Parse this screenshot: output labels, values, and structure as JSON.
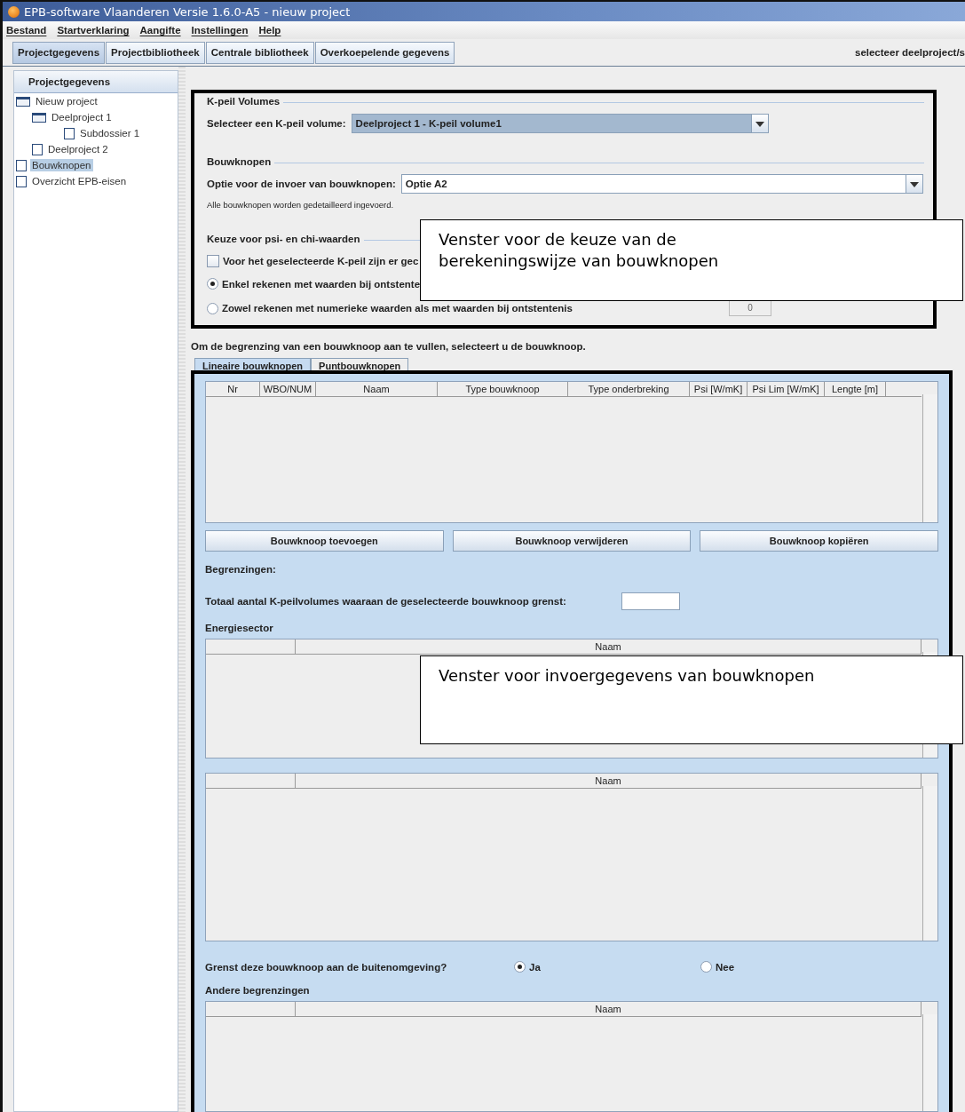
{
  "window": {
    "title": "EPB-software Vlaanderen Versie 1.6.0-A5 - nieuw project"
  },
  "menu": [
    "Bestand",
    "Startverklaring",
    "Aangifte",
    "Instellingen",
    "Help"
  ],
  "tabs": [
    {
      "label": "Projectgegevens",
      "selected": true
    },
    {
      "label": "Projectbibliotheek",
      "selected": false
    },
    {
      "label": "Centrale bibliotheek",
      "selected": false
    },
    {
      "label": "Overkoepelende gegevens",
      "selected": false
    }
  ],
  "tab_hint": "selecteer deelproject/s",
  "sidebar": {
    "title": "Projectgegevens",
    "items": [
      {
        "label": "Nieuw project",
        "kind": "folder",
        "selected": false,
        "children": [
          {
            "label": "Deelproject  1",
            "kind": "folder",
            "selected": false,
            "children": [
              {
                "label": "Subdossier 1",
                "kind": "file",
                "selected": false
              }
            ]
          },
          {
            "label": "Deelproject  2",
            "kind": "file",
            "selected": false
          }
        ]
      },
      {
        "label": "Bouwknopen",
        "kind": "file",
        "selected": true
      },
      {
        "label": "Overzicht EPB-eisen",
        "kind": "file",
        "selected": false
      }
    ]
  },
  "kpeil": {
    "title": "K-peil Volumes",
    "label": "Selecteer een K-peil volume:",
    "value": "Deelproject  1 - K-peil volume1"
  },
  "bouwknopen": {
    "title": "Bouwknopen",
    "label": "Optie voor de invoer van bouwknopen:",
    "value": "Optie A2",
    "note": "Alle bouwknopen worden gedetailleerd ingevoerd."
  },
  "keuze": {
    "title": "Keuze voor psi- en chi-waarden",
    "checkbox": {
      "label": "Voor het geselecteerde K-peil zijn er gec",
      "checked": false
    },
    "radios": [
      {
        "label": "Enkel rekenen met waarden bij ontstente",
        "selected": true
      },
      {
        "label": "Zowel rekenen met numerieke waarden als met waarden bij ontstentenis",
        "selected": false
      }
    ],
    "field": "0"
  },
  "callouts": [
    "Venster voor de keuze van de berekeningswijze van bouwknopen",
    "Venster voor invoergegevens van bouwknopen"
  ],
  "instruction": "Om de begrenzing van een bouwknoop aan te vullen, selecteert u de bouwknoop.",
  "subtabs": [
    {
      "label": "Lineaire bouwknopen",
      "selected": true
    },
    {
      "label": "Puntbouwknopen",
      "selected": false
    }
  ],
  "table": {
    "columns": [
      "Nr",
      "WBO/NUM",
      "Naam",
      "Type bouwknoop",
      "Type onderbreking",
      "Psi [W/mK]",
      "Psi Lim [W/mK]",
      "Lengte [m]"
    ]
  },
  "buttons": [
    "Bouwknoop toevoegen",
    "Bouwknoop verwijderen",
    "Bouwknoop kopiëren"
  ],
  "begrenzingen": "Begrenzingen:",
  "totaal": {
    "label": "Totaal aantal K-peilvolumes waaraan de geselecteerde bouwknoop grenst:"
  },
  "energiesector": {
    "title": "Energiesector",
    "column": "Naam"
  },
  "table_2": {
    "column": "Naam"
  },
  "buitenomgeving": {
    "label": "Grenst deze bouwknoop aan de buitenomgeving?",
    "options": [
      {
        "label": "Ja",
        "selected": true
      },
      {
        "label": "Nee",
        "selected": false
      }
    ]
  },
  "andere": {
    "title": "Andere begrenzingen",
    "column": "Naam"
  }
}
